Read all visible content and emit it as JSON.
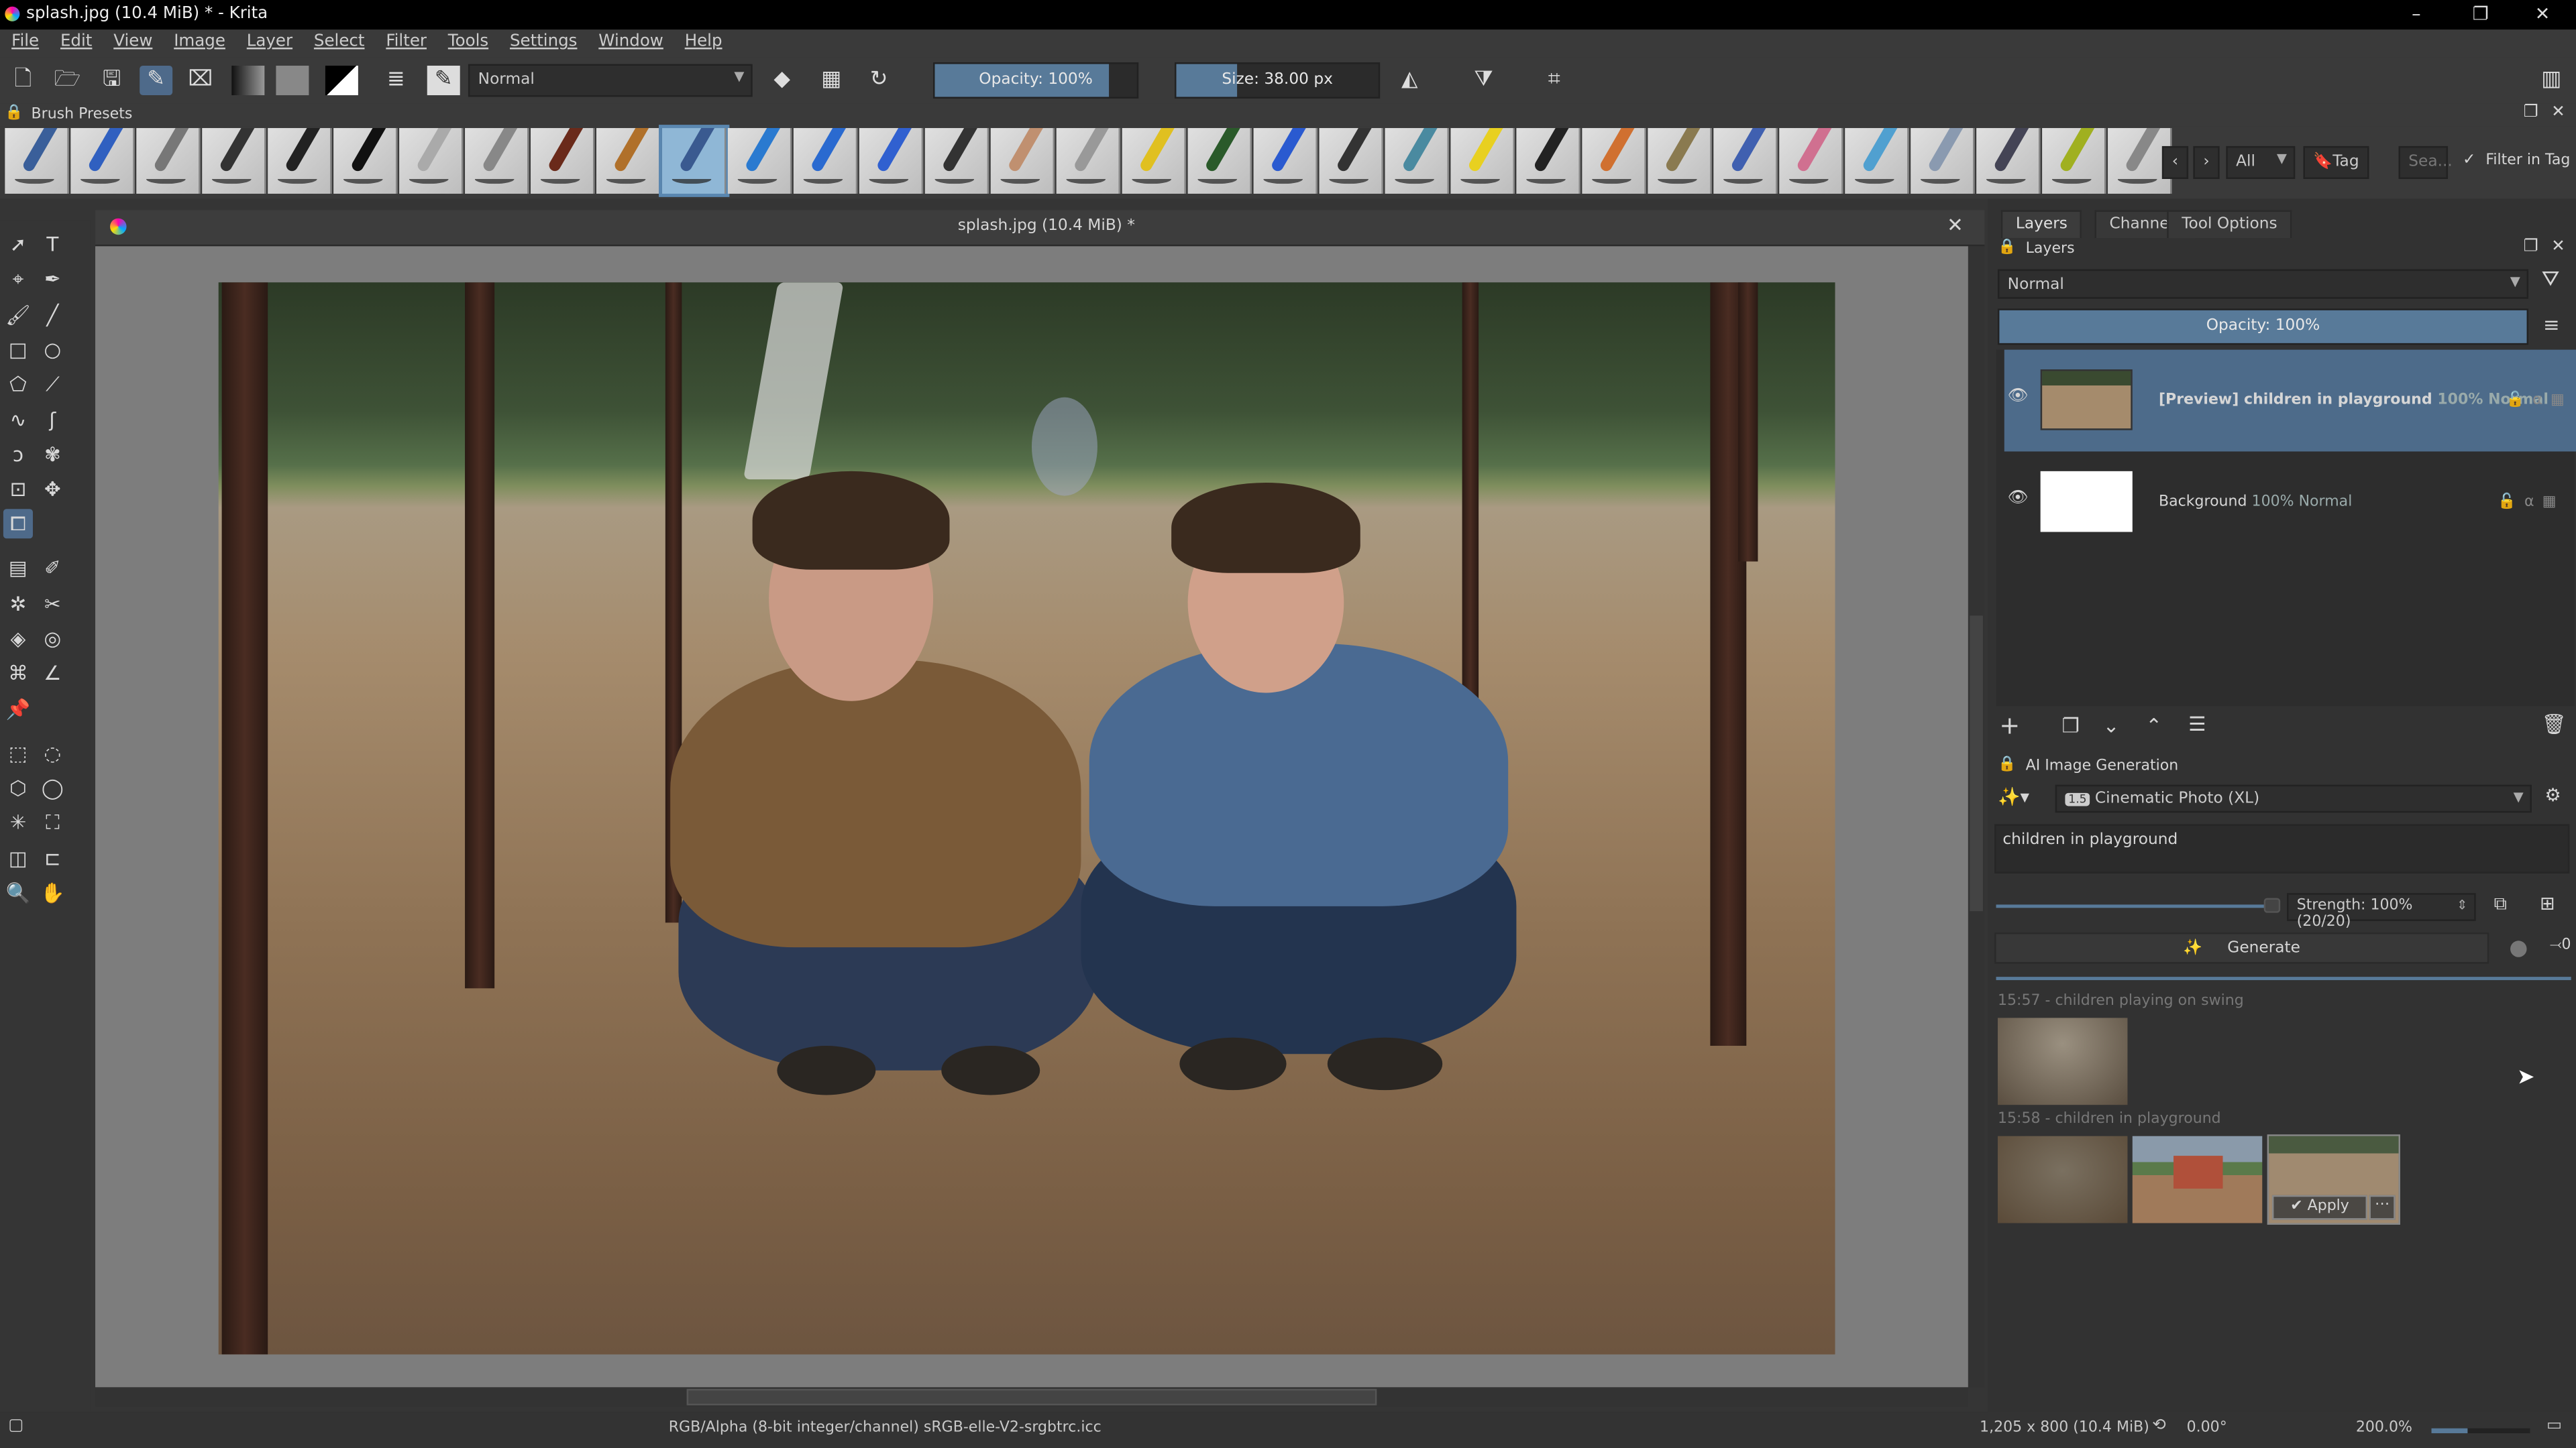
{
  "window": {
    "title": "splash.jpg (10.4 MiB) * - Krita",
    "minimize": "–",
    "maximize": "❐",
    "close": "✕"
  },
  "menu": [
    "File",
    "Edit",
    "View",
    "Image",
    "Layer",
    "Select",
    "Filter",
    "Tools",
    "Settings",
    "Window",
    "Help"
  ],
  "toolbar": {
    "blend_mode": "Normal",
    "opacity": "Opacity: 100%",
    "opacity_value": 1.0,
    "size": "Size: 38.00 px"
  },
  "brush_presets": {
    "label": "Brush Presets",
    "tile_colors": [
      "#3a5f9a",
      "#3060c0",
      "#777",
      "#333",
      "#222",
      "#111",
      "#aaa",
      "#888",
      "#6a2a1a",
      "#b0702a",
      "#3a5a90",
      "#2a7ad0",
      "#2a6ad0",
      "#3060d0",
      "#333",
      "#c09070",
      "#999",
      "#e0c020",
      "#2a5a2a",
      "#2a5ad0",
      "#333",
      "#4a8aa0",
      "#e8d020",
      "#222",
      "#d07030",
      "#8a7a50",
      "#4060b0",
      "#d07090",
      "#50a0d0",
      "#8a9ab0",
      "#445",
      "#a0b020",
      "#888"
    ],
    "selected_index": 10,
    "filter_all": "All",
    "tag": "Tag",
    "search_placeholder": "Sea...",
    "filter_in_tag": "Filter in Tag"
  },
  "document": {
    "tab_title": "splash.jpg (10.4 MiB) *",
    "close": "✕"
  },
  "toolbox": [
    "select-shapes",
    "text",
    "edit-shapes",
    "calligraphy",
    "freehand-brush",
    "line",
    "rectangle",
    "ellipse",
    "polygon",
    "polyline",
    "bezier",
    "freehand-path",
    "dynamic-brush",
    "multibrush",
    "transform",
    "move",
    "crop",
    "",
    "gradient",
    "color-sampler",
    "colorize-mask",
    "smart-patch",
    "fill",
    "enclose-fill",
    "assistant",
    "measure",
    "reference-images",
    "",
    "rect-select",
    "ellipse-select",
    "polygon-select",
    "freehand-select",
    "contiguous-select",
    "similar-select",
    "bezier-select",
    "magnetic-select",
    "zoom",
    "pan"
  ],
  "dock": {
    "tabs": [
      "Layers",
      "Channels",
      "Tool Options"
    ],
    "layers": {
      "title": "Layers",
      "blend_mode": "Normal",
      "opacity": "Opacity:  100%",
      "opacity_value": 1.0,
      "items": [
        {
          "name": "[Preview] children in playground",
          "meta": "100% Normal",
          "selected": true
        },
        {
          "name": "Background",
          "meta": "100% Normal",
          "selected": false
        }
      ]
    },
    "ai": {
      "title": "AI Image Generation",
      "style": "Cinematic Photo (XL)",
      "style_badge": "1.5",
      "prompt": "children in playground",
      "strength": "Strength: 100% (20/20)",
      "strength_value": 1.0,
      "generate": "Generate",
      "queue_count": "0",
      "history": [
        {
          "label": "15:57 - children playing on swing",
          "count": 1
        },
        {
          "label": "15:58 - children in playground",
          "count": 3
        }
      ],
      "apply": "Apply",
      "more": "⋯"
    }
  },
  "status": {
    "color_space": "RGB/Alpha (8-bit integer/channel)  sRGB-elle-V2-srgbtrc.icc",
    "dimensions": "1,205 x 800 (10.4 MiB)",
    "rotation": "0.00°",
    "zoom": "200.0%"
  },
  "colors": {
    "accent": "#587a99",
    "selection": "#4d6b8a"
  }
}
